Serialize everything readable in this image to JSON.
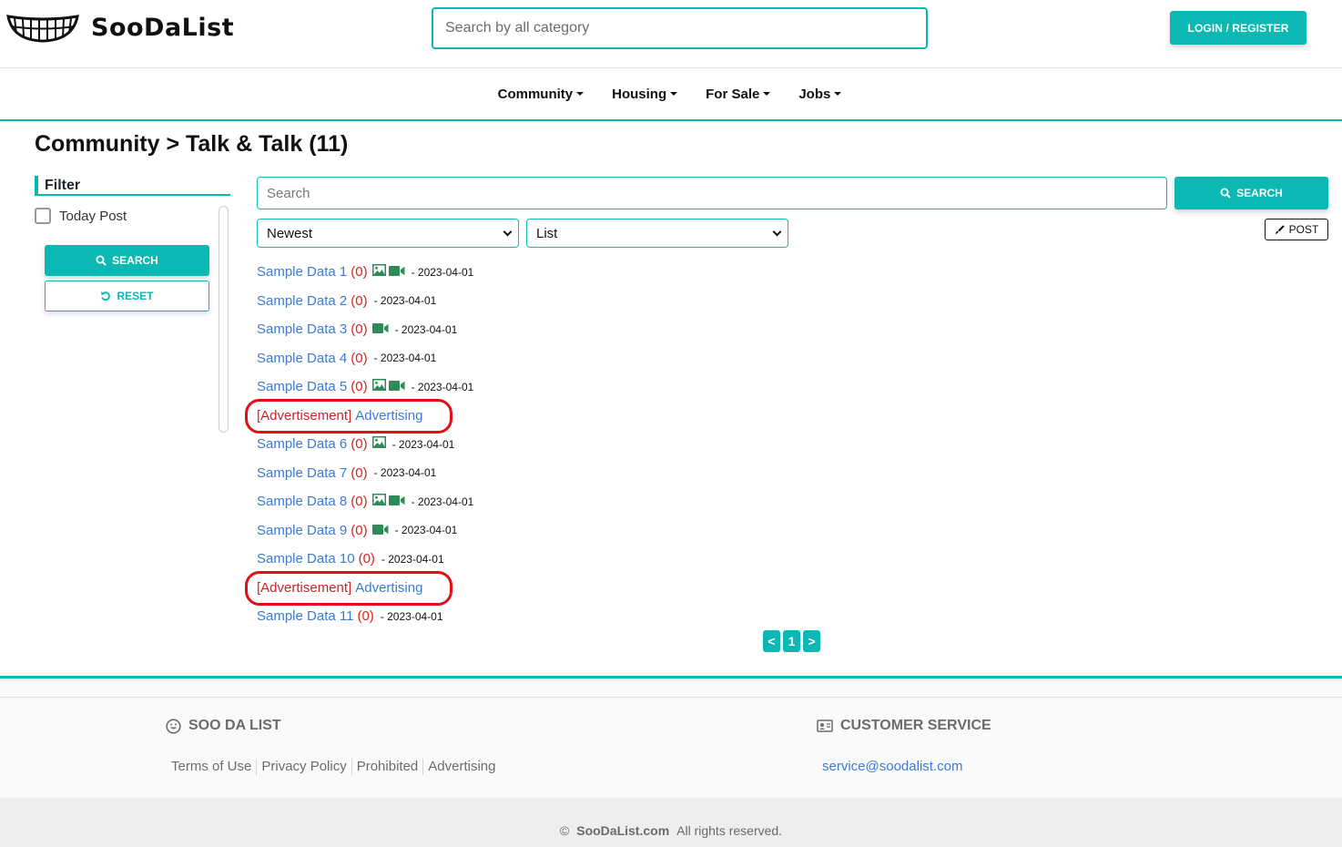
{
  "header": {
    "logo_text": "SooDaList",
    "search_placeholder": "Search by all category",
    "login_label": "LOGIN / REGISTER"
  },
  "nav": {
    "items": [
      {
        "label": "Community"
      },
      {
        "label": "Housing"
      },
      {
        "label": "For Sale"
      },
      {
        "label": "Jobs"
      }
    ]
  },
  "page": {
    "title": "Community > Talk & Talk (11)"
  },
  "filter": {
    "heading": "Filter",
    "today_post_label": "Today Post",
    "today_post_checked": false,
    "search_label": "SEARCH",
    "reset_label": "RESET"
  },
  "board": {
    "search_placeholder": "Search",
    "search_label": "SEARCH",
    "post_label": "POST",
    "sort_selected": "Newest",
    "view_selected": "List"
  },
  "posts": [
    {
      "title": "Sample Data 1",
      "count": "(0)",
      "image": true,
      "video": true,
      "date": "- 2023-04-01"
    },
    {
      "title": "Sample Data 2",
      "count": "(0)",
      "image": false,
      "video": false,
      "date": "- 2023-04-01"
    },
    {
      "title": "Sample Data 3",
      "count": "(0)",
      "image": false,
      "video": true,
      "date": "- 2023-04-01"
    },
    {
      "title": "Sample Data 4",
      "count": "(0)",
      "image": false,
      "video": false,
      "date": "- 2023-04-01"
    },
    {
      "title": "Sample Data 5",
      "count": "(0)",
      "image": true,
      "video": true,
      "date": "- 2023-04-01"
    },
    {
      "ad": true,
      "tag": "[Advertisement]",
      "title": "Advertising"
    },
    {
      "title": "Sample Data 6",
      "count": "(0)",
      "image": true,
      "video": false,
      "date": "- 2023-04-01"
    },
    {
      "title": "Sample Data 7",
      "count": "(0)",
      "image": false,
      "video": false,
      "date": "- 2023-04-01"
    },
    {
      "title": "Sample Data 8",
      "count": "(0)",
      "image": true,
      "video": true,
      "date": "- 2023-04-01"
    },
    {
      "title": "Sample Data 9",
      "count": "(0)",
      "image": false,
      "video": true,
      "date": "- 2023-04-01"
    },
    {
      "title": "Sample Data 10",
      "count": "(0)",
      "image": false,
      "video": false,
      "date": "- 2023-04-01"
    },
    {
      "ad": true,
      "tag": "[Advertisement]",
      "title": "Advertising"
    },
    {
      "title": "Sample Data 11",
      "count": "(0)",
      "image": false,
      "video": false,
      "date": "- 2023-04-01"
    }
  ],
  "pagination": {
    "prev": "<",
    "current": "1",
    "next": ">"
  },
  "footer": {
    "left_title": "SOO DA LIST",
    "links": [
      "Terms of Use",
      "Privacy Policy",
      "Prohibited",
      "Advertising"
    ],
    "right_title": "CUSTOMER SERVICE",
    "email": "service@soodalist.com",
    "copyright_symbol": "©",
    "copyright_brand": "SooDaList.com",
    "copyright_text": "All rights reserved."
  },
  "colors": {
    "accent": "#0bb8b3",
    "link": "#3a7bd5",
    "count": "#e0201c",
    "ad_tag": "#cc2529",
    "annotation": "#e0101a",
    "media_icon": "#2e8b57"
  }
}
